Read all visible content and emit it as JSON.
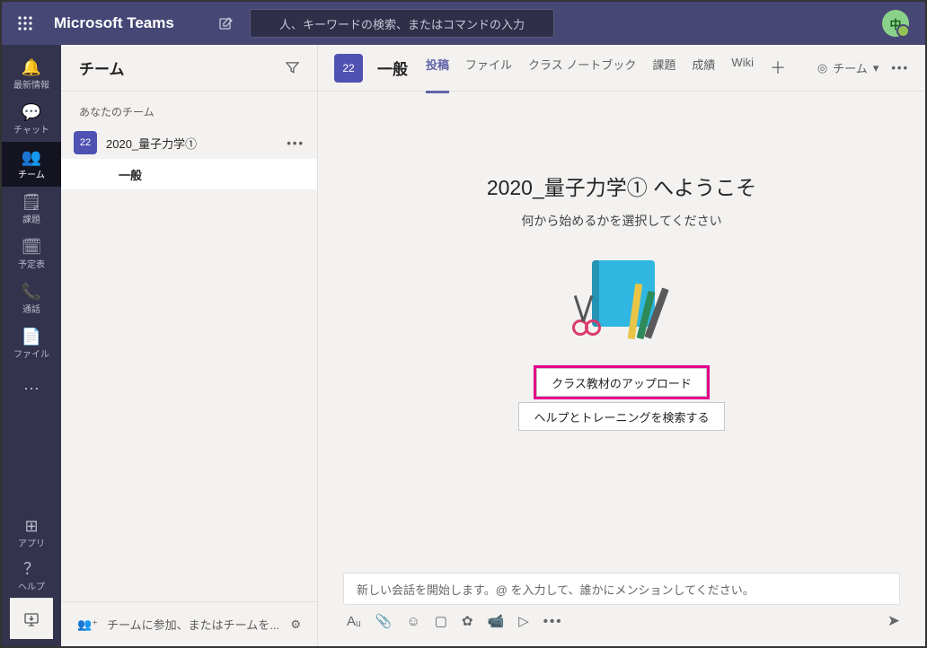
{
  "colors": {
    "brand": "#464775",
    "railDark": "#33334d",
    "accent": "#6264a7",
    "highlight": "#e3008c"
  },
  "topbar": {
    "app_title": "Microsoft Teams",
    "search_placeholder": "人、キーワードの検索、またはコマンドの入力",
    "avatar_initial": "中"
  },
  "rail": {
    "items": [
      {
        "icon": "bell-icon",
        "label": "最新情報"
      },
      {
        "icon": "chat-icon",
        "label": "チャット"
      },
      {
        "icon": "teams-icon",
        "label": "チーム",
        "active": true
      },
      {
        "icon": "assignments-icon",
        "label": "課題"
      },
      {
        "icon": "calendar-icon",
        "label": "予定表"
      },
      {
        "icon": "calls-icon",
        "label": "通話"
      },
      {
        "icon": "files-icon",
        "label": "ファイル"
      }
    ],
    "bottom": [
      {
        "icon": "apps-icon",
        "label": "アプリ"
      },
      {
        "icon": "help-icon",
        "label": "ヘルプ"
      }
    ]
  },
  "left": {
    "title": "チーム",
    "section": "あなたのチーム",
    "team": {
      "initial": "22",
      "name": "2020_量子力学①"
    },
    "channel": {
      "name": "一般"
    },
    "join_text": "チームに参加、またはチームを..."
  },
  "main": {
    "chip_initial": "22",
    "channel_title": "一般",
    "tabs": [
      "投稿",
      "ファイル",
      "クラス ノートブック",
      "課題",
      "成績",
      "Wiki"
    ],
    "team_button": "チーム",
    "welcome_title": "2020_量子力学① へようこそ",
    "welcome_sub": "何から始めるかを選択してください",
    "action_primary": "クラス教材のアップロード",
    "action_secondary": "ヘルプとトレーニングを検索する",
    "compose_placeholder": "新しい会話を開始します。@ を入力して、誰かにメンションしてください。"
  }
}
